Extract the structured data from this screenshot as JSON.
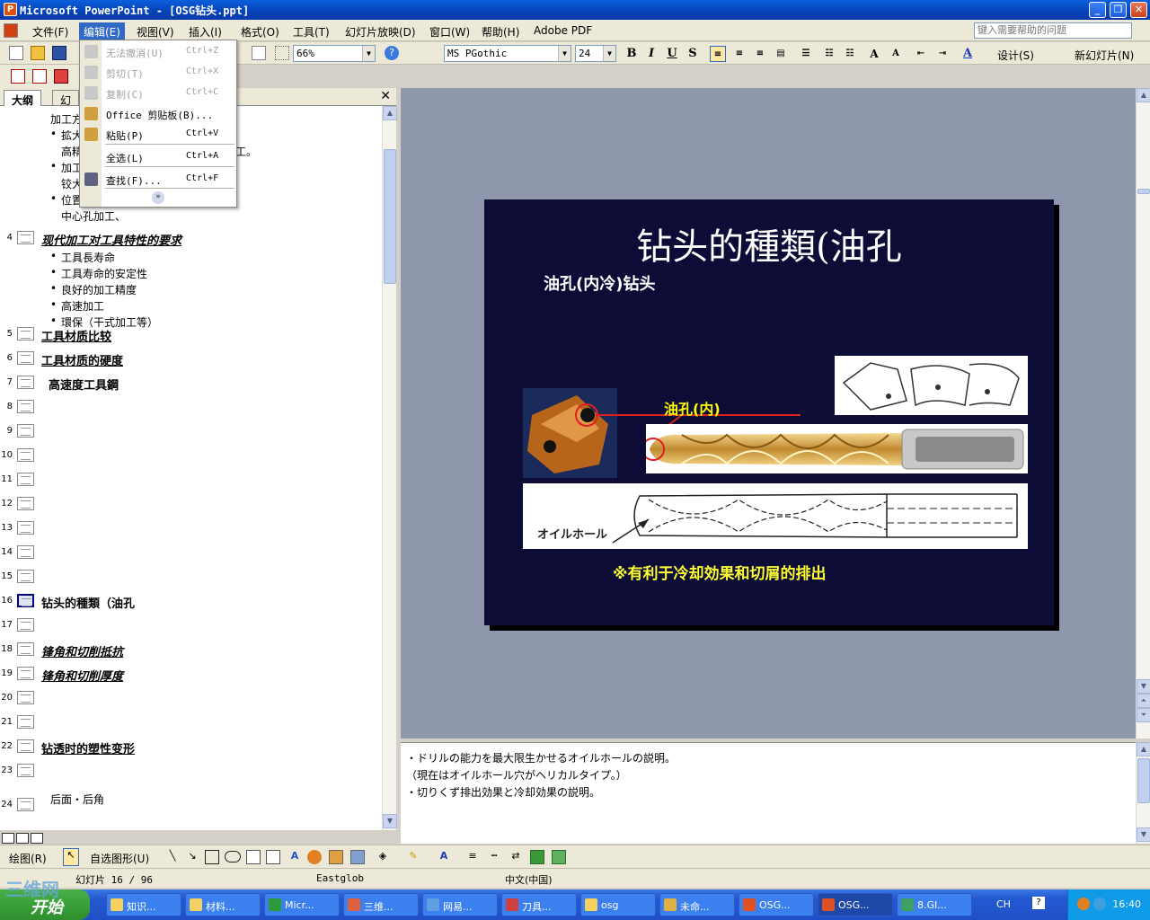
{
  "window": {
    "title": "Microsoft PowerPoint - [OSG钻头.ppt]",
    "controls": [
      "minimize-icon",
      "restore-icon",
      "close-icon"
    ]
  },
  "menubar": {
    "items": [
      "文件(F)",
      "编辑(E)",
      "视图(V)",
      "插入(I)",
      "格式(O)",
      "工具(T)",
      "幻灯片放映(D)",
      "窗口(W)",
      "帮助(H)",
      "Adobe PDF"
    ],
    "active_index": 1,
    "help_placeholder": "键入需要帮助的问题"
  },
  "toolbar": {
    "zoom": "66%",
    "font_name": "MS PGothic",
    "font_size": "24",
    "design_label": "设计(S)",
    "new_slide_label": "新幻灯片(N)"
  },
  "edit_menu": {
    "items": [
      {
        "label": "无法撤消(U)",
        "shortcut": "Ctrl+Z",
        "disabled": true,
        "icon": "undo-icon"
      },
      {
        "label": "剪切(T)",
        "shortcut": "Ctrl+X",
        "disabled": true,
        "icon": "cut-icon"
      },
      {
        "label": "复制(C)",
        "shortcut": "Ctrl+C",
        "disabled": true,
        "icon": "copy-icon"
      },
      {
        "label": "Office 剪贴板(B)...",
        "shortcut": "",
        "disabled": false,
        "icon": "clipboard-icon"
      },
      {
        "label": "粘贴(P)",
        "shortcut": "Ctrl+V",
        "disabled": false,
        "icon": "paste-icon"
      },
      {
        "label": "全选(L)",
        "shortcut": "Ctrl+A",
        "disabled": false,
        "icon": ""
      },
      {
        "label": "查找(F)...",
        "shortcut": "Ctrl+F",
        "disabled": false,
        "icon": "binoculars-icon"
      }
    ]
  },
  "left_pane": {
    "tabs": [
      "大纲",
      "幻灯片"
    ],
    "outline_top_lines": [
      "加工方",
      "拡大",
      "高精",
      "工。",
      "加工",
      "铰大",
      "位置",
      "中心孔加工、"
    ],
    "slide4_title": "现代加工对工具特性的要求",
    "slide4_bullets": [
      "工具長寿命",
      "工具寿命的安定性",
      "良好的加工精度",
      "高速加工",
      "環保（干式加工等）"
    ],
    "slides": [
      {
        "num": "5",
        "title": "工具材质比较",
        "style": "normal"
      },
      {
        "num": "6",
        "title": "工具材质的硬度",
        "style": "normal"
      },
      {
        "num": "7",
        "title": "高速度工具鋼",
        "style": "plain"
      },
      {
        "num": "8",
        "title": "",
        "style": "normal"
      },
      {
        "num": "9",
        "title": "",
        "style": "normal"
      },
      {
        "num": "10",
        "title": "",
        "style": "normal"
      },
      {
        "num": "11",
        "title": "",
        "style": "normal"
      },
      {
        "num": "12",
        "title": "",
        "style": "normal"
      },
      {
        "num": "13",
        "title": "",
        "style": "normal"
      },
      {
        "num": "14",
        "title": "",
        "style": "normal"
      },
      {
        "num": "15",
        "title": "",
        "style": "normal"
      },
      {
        "num": "16",
        "title": "钻头的種類（油孔",
        "style": "plain"
      },
      {
        "num": "17",
        "title": "",
        "style": "normal"
      },
      {
        "num": "18",
        "title": "锋角和切削抵抗",
        "style": "italic"
      },
      {
        "num": "19",
        "title": "锋角和切削厚度",
        "style": "italic"
      },
      {
        "num": "20",
        "title": "",
        "style": "normal"
      },
      {
        "num": "21",
        "title": "",
        "style": "normal"
      },
      {
        "num": "22",
        "title": "钻透时的塑性变形",
        "style": "normal"
      },
      {
        "num": "23",
        "title": "",
        "style": "normal"
      },
      {
        "num": "24",
        "title": "",
        "style": "normal"
      }
    ],
    "slide23_body": "后面・后角",
    "selected_slide": "16"
  },
  "slide": {
    "title": "钻头的種類(油孔",
    "subtitle": "油孔(内冷)钻头",
    "oil_hole_label": "油孔(内)",
    "diagram_label": "オイルホール",
    "note": "※有利于冷却効果和切屑的排出",
    "background": "#0c0c36"
  },
  "notes": {
    "lines": [
      "・ドリルの能力を最大限生かせるオイルホールの説明。",
      "（現在はオイルホール穴がヘリカルタイプ。）",
      "・切りくず排出効果と冷却効果の説明。"
    ]
  },
  "drawbar": {
    "draw_label": "绘图(R)",
    "autoshape_label": "自选图形(U)"
  },
  "status": {
    "slide_pos": "幻灯片 16 / 96",
    "template": "Eastglob",
    "language": "中文(中国)"
  },
  "taskbar": {
    "start": "开始",
    "buttons": [
      "知识...",
      "材料...",
      "Micr...",
      "三维...",
      "网易...",
      "刀具...",
      "osg",
      "未命...",
      "OSG...",
      "OSG...",
      "8.GI..."
    ],
    "pressed_index": 9,
    "tray_lang": "CH",
    "clock": "16:40",
    "watermark": "三维网"
  }
}
